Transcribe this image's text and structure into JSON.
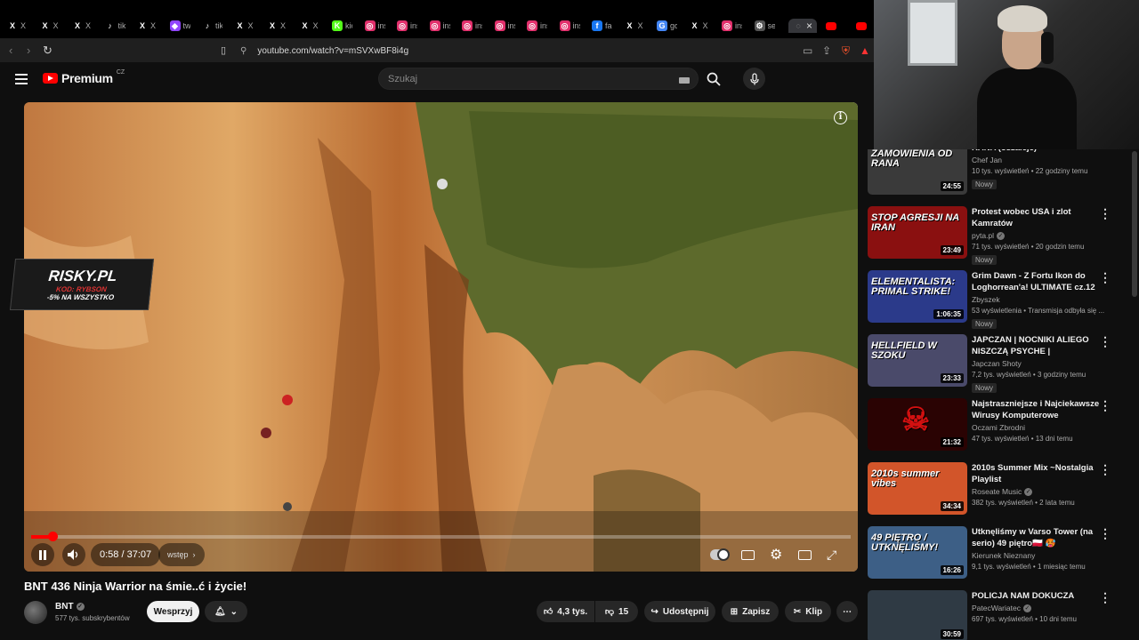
{
  "browser": {
    "tabs": [
      {
        "icon": "X",
        "label": "X",
        "color": "#000"
      },
      {
        "icon": "X",
        "label": "X",
        "color": "#000"
      },
      {
        "icon": "X",
        "label": "X",
        "color": "#000"
      },
      {
        "icon": "♪",
        "label": "tiktok",
        "color": "#000"
      },
      {
        "icon": "X",
        "label": "X",
        "color": "#000"
      },
      {
        "icon": "◆",
        "label": "twitch",
        "color": "#9146ff"
      },
      {
        "icon": "♪",
        "label": "tiktok",
        "color": "#000"
      },
      {
        "icon": "X",
        "label": "X",
        "color": "#000"
      },
      {
        "icon": "X",
        "label": "X",
        "color": "#000"
      },
      {
        "icon": "X",
        "label": "X",
        "color": "#000"
      },
      {
        "icon": "K",
        "label": "kick",
        "color": "#53fc18"
      },
      {
        "icon": "◎",
        "label": "instagram",
        "color": "#e1306c"
      },
      {
        "icon": "◎",
        "label": "instagram",
        "color": "#e1306c"
      },
      {
        "icon": "◎",
        "label": "instagram",
        "color": "#e1306c"
      },
      {
        "icon": "◎",
        "label": "instagram",
        "color": "#e1306c"
      },
      {
        "icon": "◎",
        "label": "instagram",
        "color": "#e1306c"
      },
      {
        "icon": "◎",
        "label": "instagram",
        "color": "#e1306c"
      },
      {
        "icon": "◎",
        "label": "instagram",
        "color": "#e1306c"
      },
      {
        "icon": "f",
        "label": "facebook",
        "color": "#1877f2"
      },
      {
        "icon": "X",
        "label": "X",
        "color": "#000"
      },
      {
        "icon": "G",
        "label": "google",
        "color": "#4285f4"
      },
      {
        "icon": "X",
        "label": "X",
        "color": "#000"
      },
      {
        "icon": "◎",
        "label": "instagram",
        "color": "#e1306c"
      },
      {
        "icon": "⚙",
        "label": "settings",
        "color": "#555"
      }
    ],
    "active_tab_close": "×",
    "url": "youtube.com/watch?v=mSVXwBF8i4g"
  },
  "header": {
    "logo": "Premium",
    "country": "CZ",
    "search_placeholder": "Szukaj"
  },
  "player": {
    "promo_title": "RISKY.PL",
    "promo_code": "KOD: RYBSON",
    "promo_discount": "-5% NA WSZYSTKO",
    "time": "0:58 / 37:07",
    "chapter": "wstęp",
    "progress": 0.026
  },
  "video": {
    "title": "BNT 436 Ninja Warrior na śmie..ć i życie!",
    "channel": "BNT",
    "subscribers": "577 tys. subskrybentów",
    "support_label": "Wesprzyj",
    "likes": "4,3 tys.",
    "dislikes": "15",
    "share_label": "Udostępnij",
    "save_label": "Zapisz",
    "clip_label": "Klip"
  },
  "recommendations": [
    {
      "title": "RANA (oszaleje)",
      "channel": "Chef Jan",
      "meta": "10 tys. wyświetleń • 22 godziny temu",
      "badge": "Nowy",
      "duration": "24:55",
      "thumb_text": "ZAMÓWIENIA OD RANA",
      "thumb_color": "#3a3a3a",
      "verified": false
    },
    {
      "title": "Protest wobec USA i zlot Kamratów",
      "channel": "pyta.pl",
      "meta": "71 tys. wyświetleń • 20 godzin temu",
      "badge": "Nowy",
      "duration": "23:49",
      "thumb_text": "STOP AGRESJI NA IRAN",
      "thumb_color": "#8a1010",
      "verified": true
    },
    {
      "title": "Grim Dawn - Z Fortu Ikon do Loghorrean'a! ULTIMATE cz.12",
      "channel": "Zbyszek",
      "meta": "53 wyświetlenia • Transmisja odbyła się ...",
      "badge": "Nowy",
      "duration": "1:06:35",
      "thumb_text": "ELEMENTALISTA: PRIMAL STRIKE!",
      "thumb_color": "#2b3a8a",
      "verified": false
    },
    {
      "title": "JAPCZAN | NOCNIKI ALIEGO NISZCZĄ PSYCHE |",
      "channel": "Japczan Shoty",
      "meta": "7,2 tys. wyświetleń • 3 godziny temu",
      "badge": "Nowy",
      "duration": "23:33",
      "thumb_text": "HELLFIELD W SZOKU",
      "thumb_color": "#4a4a6a",
      "verified": false
    },
    {
      "title": "Najstraszniejsze i Najciekawsze Wirusy Komputerowe",
      "channel": "Oczami Zbrodni",
      "meta": "47 tys. wyświetleń • 13 dni temu",
      "badge": "",
      "duration": "21:32",
      "thumb_text": "☠",
      "thumb_color": "#2a0303",
      "verified": false
    },
    {
      "title": "2010s Summer Mix ~Nostalgia Playlist",
      "channel": "Roseate Music",
      "meta": "382 tys. wyświetleń • 2 lata temu",
      "badge": "",
      "duration": "34:34",
      "thumb_text": "2010s summer vibes",
      "thumb_color": "#d2552a",
      "verified": true
    },
    {
      "title": "Utknęliśmy w Varso Tower (na serio) 49 piętro🇵🇱 🥵",
      "channel": "Kierunek Nieznany",
      "meta": "9,1 tys. wyświetleń • 1 miesiąc temu",
      "badge": "",
      "duration": "16:26",
      "thumb_text": "49 PIĘTRO / UTKNĘLIŚMY!",
      "thumb_color": "#3d5f86",
      "verified": false
    },
    {
      "title": "POLICJA NAM DOKUCZA",
      "channel": "PatecWariatec",
      "meta": "697 tys. wyświetleń • 10 dni temu",
      "badge": "",
      "duration": "30:59",
      "thumb_text": "",
      "thumb_color": "#2f3a44",
      "verified": true
    }
  ],
  "colors": {
    "accent": "#ff0000",
    "background": "#0f0f0f"
  }
}
